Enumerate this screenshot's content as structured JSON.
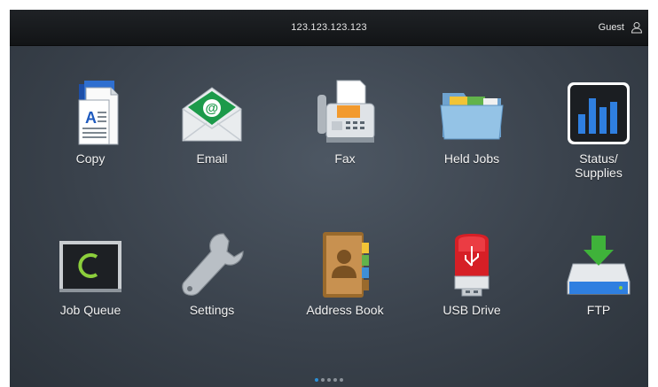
{
  "header": {
    "address": "123.123.123.123",
    "user_label": "Guest",
    "user_icon": "person-outline-icon"
  },
  "apps": [
    {
      "label": "Copy",
      "icon": "copy-document-icon"
    },
    {
      "label": "Email",
      "icon": "email-envelope-icon"
    },
    {
      "label": "Fax",
      "icon": "fax-machine-icon"
    },
    {
      "label": "Held Jobs",
      "icon": "folder-icon"
    },
    {
      "label": "Status/\nSupplies",
      "icon": "status-bars-icon"
    },
    {
      "label": "Job Queue",
      "icon": "job-queue-monitor-icon"
    },
    {
      "label": "Settings",
      "icon": "wrench-icon"
    },
    {
      "label": "Address Book",
      "icon": "address-book-icon"
    },
    {
      "label": "USB Drive",
      "icon": "usb-drive-icon"
    },
    {
      "label": "FTP",
      "icon": "ftp-download-drive-icon"
    }
  ],
  "pager": {
    "total_pages": 5,
    "current_page": 1,
    "active_color": "#2c8fd6"
  },
  "colors": {
    "background": "#3a424c",
    "topbar": "#16181b",
    "label_text": "#f2f2f2"
  }
}
